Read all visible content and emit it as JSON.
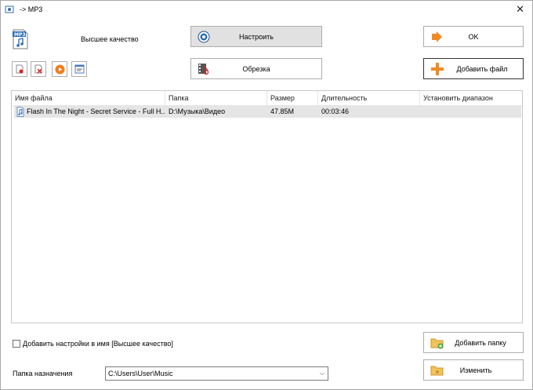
{
  "window": {
    "title": "-> MP3"
  },
  "header": {
    "quality_label": "Высшее качество"
  },
  "buttons": {
    "configure": "Настроить",
    "trim": "Обрезка",
    "ok": "OK",
    "add_file": "Добавить файл",
    "add_folder": "Добавить папку",
    "change": "Изменить"
  },
  "list": {
    "columns": [
      "Имя файла",
      "Папка",
      "Размер",
      "Длительность",
      "Установить диапазон"
    ],
    "rows": [
      {
        "name": "Flash In The Night - Secret Service - Full H...",
        "folder": "D:\\Музыка\\Видео",
        "size": "47.85M",
        "duration": "00:03:46",
        "range": ""
      }
    ]
  },
  "options": {
    "add_settings_to_name": "Добавить настройки в имя [Высшее качество]",
    "checked": false
  },
  "destination": {
    "label": "Папка назначения",
    "path": "C:\\Users\\User\\Music"
  }
}
